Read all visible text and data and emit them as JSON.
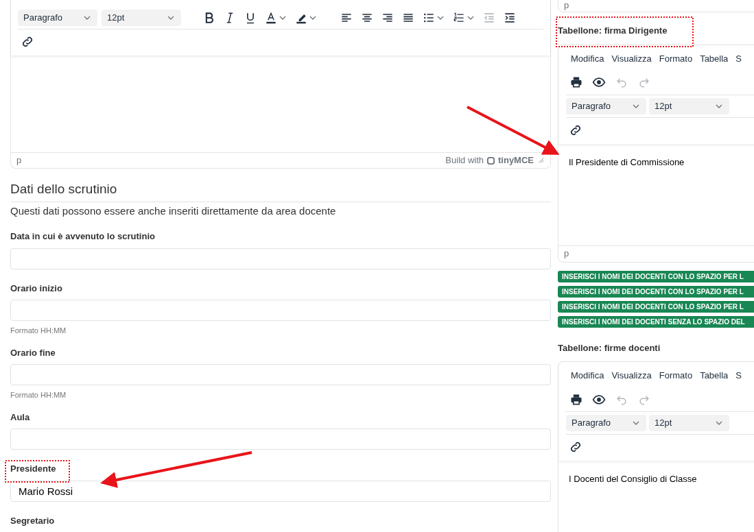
{
  "main_editor": {
    "format_select": "Paragrafo",
    "size_select": "12pt",
    "toolbar": [
      {
        "kind": "bold",
        "disabled": false
      },
      {
        "kind": "italic",
        "disabled": false
      },
      {
        "kind": "underline",
        "disabled": false
      },
      {
        "kind": "text-color",
        "disabled": false
      },
      {
        "kind": "highlight",
        "disabled": false
      },
      {
        "kind": "align-left",
        "disabled": false
      },
      {
        "kind": "align-center",
        "disabled": false
      },
      {
        "kind": "align-right",
        "disabled": false
      },
      {
        "kind": "justify",
        "disabled": false
      },
      {
        "kind": "bullet-list",
        "disabled": false
      },
      {
        "kind": "number-list",
        "disabled": false
      },
      {
        "kind": "outdent",
        "disabled": true
      },
      {
        "kind": "indent",
        "disabled": false
      }
    ],
    "status_path": "p",
    "branding": "Build with",
    "brand_name": "tinyMCE"
  },
  "section": {
    "title": "Dati dello scrutinio",
    "description": "Questi dati possono essere anche inseriti direttamente da area docente",
    "fields": [
      {
        "label": "Data in cui è avvenuto lo scrutinio"
      },
      {
        "label": "Orario inizio",
        "help": "Formato HH:MM"
      },
      {
        "label": "Orario fine",
        "help": "Formato HH:MM"
      },
      {
        "label": "Aula"
      },
      {
        "label": "Presidente",
        "value": "Mario Rossi"
      },
      {
        "label": "Segretario"
      }
    ]
  },
  "side": {
    "previous_status_path": "p",
    "editors": [
      {
        "title": "Tabellone: firma Dirigente",
        "menu": [
          "Modifica",
          "Visualizza",
          "Formato",
          "Tabella",
          "S"
        ],
        "tools": [
          {
            "kind": "print",
            "disabled": false
          },
          {
            "kind": "preview",
            "disabled": false
          },
          {
            "kind": "undo",
            "disabled": true
          },
          {
            "kind": "redo",
            "disabled": true
          }
        ],
        "format_select": "Paragrafo",
        "size_select": "12pt",
        "content": "Il Presidente di Commissione",
        "status_path": "p",
        "buttons": [
          "INSERISCI I NOMI DEI DOCENTI CON LO SPAZIO PER L",
          "INSERISCI I NOMI DEI DOCENTI CON LO SPAZIO PER L",
          "INSERISCI I NOMI DEI DOCENTI CON LO SPAZIO PER L",
          "INSERISCI I NOMI DEI DOCENTI SENZA LO SPAZIO DEL"
        ]
      },
      {
        "title": "Tabellone: firme docenti",
        "menu": [
          "Modifica",
          "Visualizza",
          "Formato",
          "Tabella",
          "S"
        ],
        "tools": [
          {
            "kind": "print",
            "disabled": false
          },
          {
            "kind": "preview",
            "disabled": false
          },
          {
            "kind": "undo",
            "disabled": true
          },
          {
            "kind": "redo",
            "disabled": true
          }
        ],
        "format_select": "Paragrafo",
        "size_select": "12pt",
        "content": "I Docenti del Consiglio di Classe"
      }
    ]
  }
}
